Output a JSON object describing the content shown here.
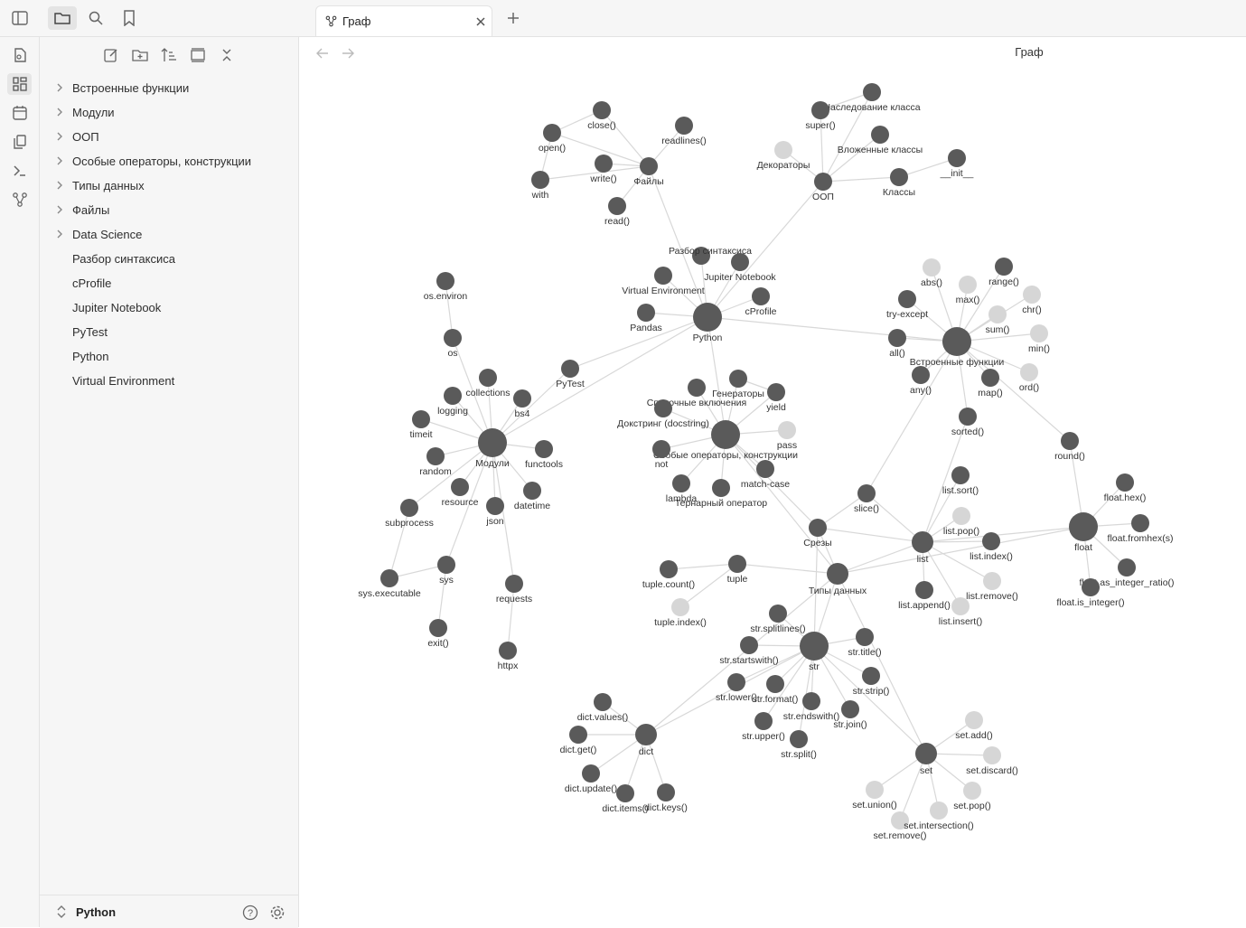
{
  "ribbon": {
    "items": [
      "file-icon",
      "grid-icon",
      "calendar-icon",
      "copy-icon",
      "terminal-icon",
      "graph-icon"
    ]
  },
  "sidebar": {
    "items": [
      {
        "label": "Встроенные функции",
        "folder": true
      },
      {
        "label": "Модули",
        "folder": true
      },
      {
        "label": "ООП",
        "folder": true
      },
      {
        "label": "Особые операторы, конструкции",
        "folder": true
      },
      {
        "label": "Типы данных",
        "folder": true
      },
      {
        "label": "Файлы",
        "folder": true
      },
      {
        "label": "Data Science",
        "folder": true
      },
      {
        "label": "Разбор синтаксиса",
        "folder": false
      },
      {
        "label": "cProfile",
        "folder": false
      },
      {
        "label": "Jupiter Notebook",
        "folder": false
      },
      {
        "label": "PyTest",
        "folder": false
      },
      {
        "label": "Python",
        "folder": false
      },
      {
        "label": "Virtual Environment",
        "folder": false
      }
    ],
    "vault_name": "Python"
  },
  "tab": {
    "title": "Граф"
  },
  "view": {
    "title": "Граф"
  },
  "graph": {
    "nodes": [
      {
        "id": "python",
        "label": "Python",
        "size": "big"
      },
      {
        "id": "builtins",
        "label": "Встроенные функции",
        "size": "big"
      },
      {
        "id": "modules",
        "label": "Модули",
        "size": "big"
      },
      {
        "id": "specops",
        "label": "Особые операторы, конструкции",
        "size": "big"
      },
      {
        "id": "types",
        "label": "Типы данных",
        "size": "med"
      },
      {
        "id": "str",
        "label": "str",
        "size": "big"
      },
      {
        "id": "list",
        "label": "list",
        "size": "med"
      },
      {
        "id": "float",
        "label": "float",
        "size": "big"
      },
      {
        "id": "set",
        "label": "set",
        "size": "med"
      },
      {
        "id": "dict",
        "label": "dict",
        "size": "med"
      },
      {
        "id": "oop",
        "label": "ООП",
        "size": "small"
      },
      {
        "id": "files",
        "label": "Файлы",
        "size": "small"
      },
      {
        "id": "close",
        "label": "close()",
        "size": "small"
      },
      {
        "id": "open",
        "label": "open()",
        "size": "small"
      },
      {
        "id": "readlines",
        "label": "readlines()",
        "size": "small"
      },
      {
        "id": "write",
        "label": "write()",
        "size": "small"
      },
      {
        "id": "with",
        "label": "with",
        "size": "small"
      },
      {
        "id": "read",
        "label": "read()",
        "size": "small"
      },
      {
        "id": "inherit",
        "label": "Наследование класса",
        "size": "small"
      },
      {
        "id": "super",
        "label": "super()",
        "size": "small"
      },
      {
        "id": "nested",
        "label": "Вложенные классы",
        "size": "small"
      },
      {
        "id": "decor",
        "label": "Декораторы",
        "size": "small",
        "ghost": true
      },
      {
        "id": "classes",
        "label": "Классы",
        "size": "small"
      },
      {
        "id": "init",
        "label": "__init__",
        "size": "small"
      },
      {
        "id": "razbor",
        "label": "Разбор синтаксиса",
        "size": "small"
      },
      {
        "id": "jupiter",
        "label": "Jupiter Notebook",
        "size": "small"
      },
      {
        "id": "venv",
        "label": "Virtual Environment",
        "size": "small"
      },
      {
        "id": "cprofile",
        "label": "cProfile",
        "size": "small"
      },
      {
        "id": "pandas",
        "label": "Pandas",
        "size": "small"
      },
      {
        "id": "pytest",
        "label": "PyTest",
        "size": "small"
      },
      {
        "id": "abs",
        "label": "abs()",
        "size": "small",
        "ghost": true
      },
      {
        "id": "range",
        "label": "range()",
        "size": "small"
      },
      {
        "id": "max",
        "label": "max()",
        "size": "small",
        "ghost": true
      },
      {
        "id": "chr",
        "label": "chr()",
        "size": "small",
        "ghost": true
      },
      {
        "id": "tryexcept",
        "label": "try-except",
        "size": "small"
      },
      {
        "id": "sum",
        "label": "sum()",
        "size": "small",
        "ghost": true
      },
      {
        "id": "min",
        "label": "min()",
        "size": "small",
        "ghost": true
      },
      {
        "id": "all",
        "label": "all()",
        "size": "small"
      },
      {
        "id": "ord",
        "label": "ord()",
        "size": "small",
        "ghost": true
      },
      {
        "id": "any",
        "label": "any()",
        "size": "small"
      },
      {
        "id": "map",
        "label": "map()",
        "size": "small"
      },
      {
        "id": "sorted",
        "label": "sorted()",
        "size": "small"
      },
      {
        "id": "round",
        "label": "round()",
        "size": "small"
      },
      {
        "id": "osenv",
        "label": "os.environ",
        "size": "small"
      },
      {
        "id": "os",
        "label": "os",
        "size": "small"
      },
      {
        "id": "collections",
        "label": "collections",
        "size": "small"
      },
      {
        "id": "bs4",
        "label": "bs4",
        "size": "small"
      },
      {
        "id": "logging",
        "label": "logging",
        "size": "small"
      },
      {
        "id": "timeit",
        "label": "timeit",
        "size": "small"
      },
      {
        "id": "functools",
        "label": "functools",
        "size": "small"
      },
      {
        "id": "random",
        "label": "random",
        "size": "small"
      },
      {
        "id": "resource",
        "label": "resource",
        "size": "small"
      },
      {
        "id": "json",
        "label": "json",
        "size": "small"
      },
      {
        "id": "datetime",
        "label": "datetime",
        "size": "small"
      },
      {
        "id": "subprocess",
        "label": "subprocess",
        "size": "small"
      },
      {
        "id": "sys",
        "label": "sys",
        "size": "small"
      },
      {
        "id": "sysexec",
        "label": "sys.executable",
        "size": "small"
      },
      {
        "id": "exit",
        "label": "exit()",
        "size": "small"
      },
      {
        "id": "requests",
        "label": "requests",
        "size": "small"
      },
      {
        "id": "httpx",
        "label": "httpx",
        "size": "small"
      },
      {
        "id": "listcomp",
        "label": "Списочные включения",
        "size": "small"
      },
      {
        "id": "gens",
        "label": "Генераторы",
        "size": "small"
      },
      {
        "id": "yield",
        "label": "yield",
        "size": "small"
      },
      {
        "id": "docstring",
        "label": "Докстринг (docstring)",
        "size": "small"
      },
      {
        "id": "pass",
        "label": "pass",
        "size": "small",
        "ghost": true
      },
      {
        "id": "not",
        "label": "not",
        "size": "small"
      },
      {
        "id": "lambda",
        "label": "lambda",
        "size": "small"
      },
      {
        "id": "ternary",
        "label": "Тернарный оператор",
        "size": "small"
      },
      {
        "id": "match",
        "label": "match-case",
        "size": "small"
      },
      {
        "id": "slice",
        "label": "slice()",
        "size": "small"
      },
      {
        "id": "slices",
        "label": "Срезы",
        "size": "small"
      },
      {
        "id": "listsort",
        "label": "list.sort()",
        "size": "small"
      },
      {
        "id": "listpop",
        "label": "list.pop()",
        "size": "small",
        "ghost": true
      },
      {
        "id": "listindex",
        "label": "list.index()",
        "size": "small"
      },
      {
        "id": "listremove",
        "label": "list.remove()",
        "size": "small",
        "ghost": true
      },
      {
        "id": "listappend",
        "label": "list.append()",
        "size": "small"
      },
      {
        "id": "listinsert",
        "label": "list.insert()",
        "size": "small",
        "ghost": true
      },
      {
        "id": "floathex",
        "label": "float.hex()",
        "size": "small"
      },
      {
        "id": "floatfromhex",
        "label": "float.fromhex(s)",
        "size": "small"
      },
      {
        "id": "floatratio",
        "label": "float.as_integer_ratio()",
        "size": "small"
      },
      {
        "id": "floatisint",
        "label": "float.is_integer()",
        "size": "small"
      },
      {
        "id": "tuple",
        "label": "tuple",
        "size": "small"
      },
      {
        "id": "tuplecount",
        "label": "tuple.count()",
        "size": "small"
      },
      {
        "id": "tupleindex",
        "label": "tuple.index()",
        "size": "small",
        "ghost": true
      },
      {
        "id": "strsplitlines",
        "label": "str.splitlines()",
        "size": "small"
      },
      {
        "id": "strtitle",
        "label": "str.title()",
        "size": "small"
      },
      {
        "id": "strstartswith",
        "label": "str.startswith()",
        "size": "small"
      },
      {
        "id": "strstrip",
        "label": "str.strip()",
        "size": "small"
      },
      {
        "id": "strlower",
        "label": "str.lower()",
        "size": "small"
      },
      {
        "id": "strformat",
        "label": "str.format()",
        "size": "small"
      },
      {
        "id": "strendswith",
        "label": "str.endswith()",
        "size": "small"
      },
      {
        "id": "strjoin",
        "label": "str.join()",
        "size": "small"
      },
      {
        "id": "strupper",
        "label": "str.upper()",
        "size": "small"
      },
      {
        "id": "strsplit",
        "label": "str.split()",
        "size": "small"
      },
      {
        "id": "dictvalues",
        "label": "dict.values()",
        "size": "small"
      },
      {
        "id": "dictget",
        "label": "dict.get()",
        "size": "small"
      },
      {
        "id": "dictupdate",
        "label": "dict.update()",
        "size": "small"
      },
      {
        "id": "dictitems",
        "label": "dict.items()",
        "size": "small"
      },
      {
        "id": "dictkeys",
        "label": "dict.keys()",
        "size": "small"
      },
      {
        "id": "setadd",
        "label": "set.add()",
        "size": "small",
        "ghost": true
      },
      {
        "id": "setdiscard",
        "label": "set.discard()",
        "size": "small",
        "ghost": true
      },
      {
        "id": "setunion",
        "label": "set.union()",
        "size": "small",
        "ghost": true
      },
      {
        "id": "setpop",
        "label": "set.pop()",
        "size": "small",
        "ghost": true
      },
      {
        "id": "setremove",
        "label": "set.remove()",
        "size": "small",
        "ghost": true
      },
      {
        "id": "setinter",
        "label": "set.intersection()",
        "size": "small",
        "ghost": true
      }
    ],
    "edges": [
      [
        "files",
        "close"
      ],
      [
        "files",
        "open"
      ],
      [
        "files",
        "readlines"
      ],
      [
        "files",
        "write"
      ],
      [
        "files",
        "with"
      ],
      [
        "files",
        "read"
      ],
      [
        "open",
        "close"
      ],
      [
        "open",
        "with"
      ],
      [
        "files",
        "python"
      ],
      [
        "oop",
        "inherit"
      ],
      [
        "oop",
        "super"
      ],
      [
        "oop",
        "nested"
      ],
      [
        "oop",
        "decor"
      ],
      [
        "oop",
        "classes"
      ],
      [
        "classes",
        "init"
      ],
      [
        "super",
        "inherit"
      ],
      [
        "oop",
        "python"
      ],
      [
        "python",
        "razbor"
      ],
      [
        "python",
        "jupiter"
      ],
      [
        "python",
        "venv"
      ],
      [
        "python",
        "cprofile"
      ],
      [
        "python",
        "pandas"
      ],
      [
        "python",
        "builtins"
      ],
      [
        "python",
        "modules"
      ],
      [
        "python",
        "specops"
      ],
      [
        "python",
        "pytest"
      ],
      [
        "builtins",
        "abs"
      ],
      [
        "builtins",
        "range"
      ],
      [
        "builtins",
        "max"
      ],
      [
        "builtins",
        "chr"
      ],
      [
        "builtins",
        "tryexcept"
      ],
      [
        "builtins",
        "sum"
      ],
      [
        "builtins",
        "min"
      ],
      [
        "builtins",
        "all"
      ],
      [
        "builtins",
        "ord"
      ],
      [
        "builtins",
        "any"
      ],
      [
        "builtins",
        "map"
      ],
      [
        "builtins",
        "sorted"
      ],
      [
        "builtins",
        "round"
      ],
      [
        "builtins",
        "slice"
      ],
      [
        "round",
        "float"
      ],
      [
        "modules",
        "os"
      ],
      [
        "os",
        "osenv"
      ],
      [
        "modules",
        "collections"
      ],
      [
        "modules",
        "bs4"
      ],
      [
        "modules",
        "logging"
      ],
      [
        "modules",
        "timeit"
      ],
      [
        "modules",
        "functools"
      ],
      [
        "modules",
        "random"
      ],
      [
        "modules",
        "resource"
      ],
      [
        "modules",
        "json"
      ],
      [
        "modules",
        "datetime"
      ],
      [
        "modules",
        "subprocess"
      ],
      [
        "modules",
        "sys"
      ],
      [
        "modules",
        "requests"
      ],
      [
        "modules",
        "pytest"
      ],
      [
        "sys",
        "sysexec"
      ],
      [
        "sys",
        "exit"
      ],
      [
        "subprocess",
        "sysexec"
      ],
      [
        "requests",
        "httpx"
      ],
      [
        "specops",
        "listcomp"
      ],
      [
        "specops",
        "gens"
      ],
      [
        "specops",
        "yield"
      ],
      [
        "specops",
        "docstring"
      ],
      [
        "specops",
        "pass"
      ],
      [
        "specops",
        "not"
      ],
      [
        "specops",
        "lambda"
      ],
      [
        "specops",
        "ternary"
      ],
      [
        "specops",
        "match"
      ],
      [
        "gens",
        "yield"
      ],
      [
        "specops",
        "slices"
      ],
      [
        "types",
        "str"
      ],
      [
        "types",
        "list"
      ],
      [
        "types",
        "float"
      ],
      [
        "types",
        "set"
      ],
      [
        "types",
        "dict"
      ],
      [
        "types",
        "tuple"
      ],
      [
        "types",
        "slices"
      ],
      [
        "types",
        "specops"
      ],
      [
        "slices",
        "slice"
      ],
      [
        "slices",
        "list"
      ],
      [
        "slices",
        "str"
      ],
      [
        "slice",
        "list"
      ],
      [
        "list",
        "listsort"
      ],
      [
        "list",
        "listpop"
      ],
      [
        "list",
        "listindex"
      ],
      [
        "list",
        "listremove"
      ],
      [
        "list",
        "listappend"
      ],
      [
        "list",
        "listinsert"
      ],
      [
        "list",
        "float"
      ],
      [
        "list",
        "sorted"
      ],
      [
        "float",
        "floathex"
      ],
      [
        "float",
        "floatfromhex"
      ],
      [
        "float",
        "floatratio"
      ],
      [
        "float",
        "floatisint"
      ],
      [
        "tuple",
        "tuplecount"
      ],
      [
        "tuple",
        "tupleindex"
      ],
      [
        "str",
        "strsplitlines"
      ],
      [
        "str",
        "strtitle"
      ],
      [
        "str",
        "strstartswith"
      ],
      [
        "str",
        "strstrip"
      ],
      [
        "str",
        "strlower"
      ],
      [
        "str",
        "strformat"
      ],
      [
        "str",
        "strendswith"
      ],
      [
        "str",
        "strjoin"
      ],
      [
        "str",
        "strupper"
      ],
      [
        "str",
        "strsplit"
      ],
      [
        "str",
        "dict"
      ],
      [
        "str",
        "set"
      ],
      [
        "dict",
        "dictvalues"
      ],
      [
        "dict",
        "dictget"
      ],
      [
        "dict",
        "dictupdate"
      ],
      [
        "dict",
        "dictitems"
      ],
      [
        "dict",
        "dictkeys"
      ],
      [
        "set",
        "setadd"
      ],
      [
        "set",
        "setdiscard"
      ],
      [
        "set",
        "setunion"
      ],
      [
        "set",
        "setpop"
      ],
      [
        "set",
        "setremove"
      ],
      [
        "set",
        "setinter"
      ]
    ],
    "colors": {
      "node": "#5a5a5a",
      "ghost": "#d6d6d6",
      "edge": "#d8d8d8",
      "label": "#333333"
    }
  }
}
